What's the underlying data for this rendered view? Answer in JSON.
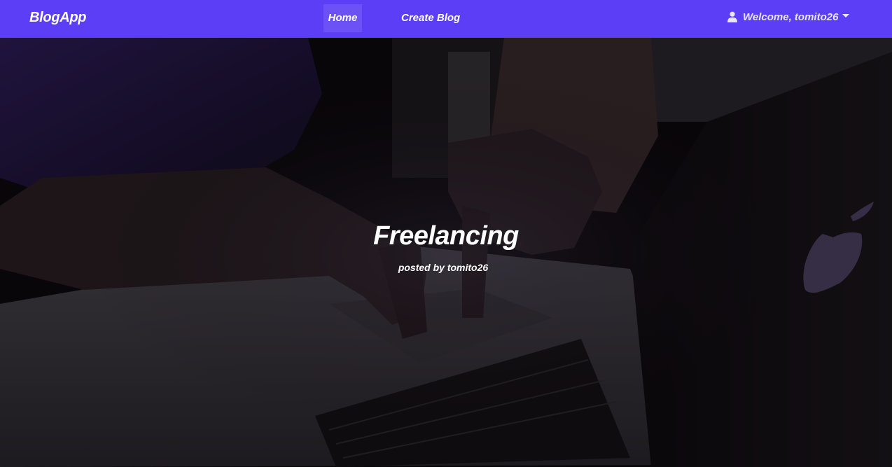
{
  "navbar": {
    "brand": "BlogApp",
    "links": [
      {
        "label": "Home",
        "active": true
      },
      {
        "label": "Create Blog",
        "active": false
      }
    ],
    "user": {
      "label": "Welcome, tomito26",
      "icon": "user-icon"
    },
    "color": "#5b3ef5"
  },
  "hero": {
    "title": "Freelancing",
    "byline": "posted by tomito26",
    "background_image": "dark photo of hands typing on a laptop"
  }
}
